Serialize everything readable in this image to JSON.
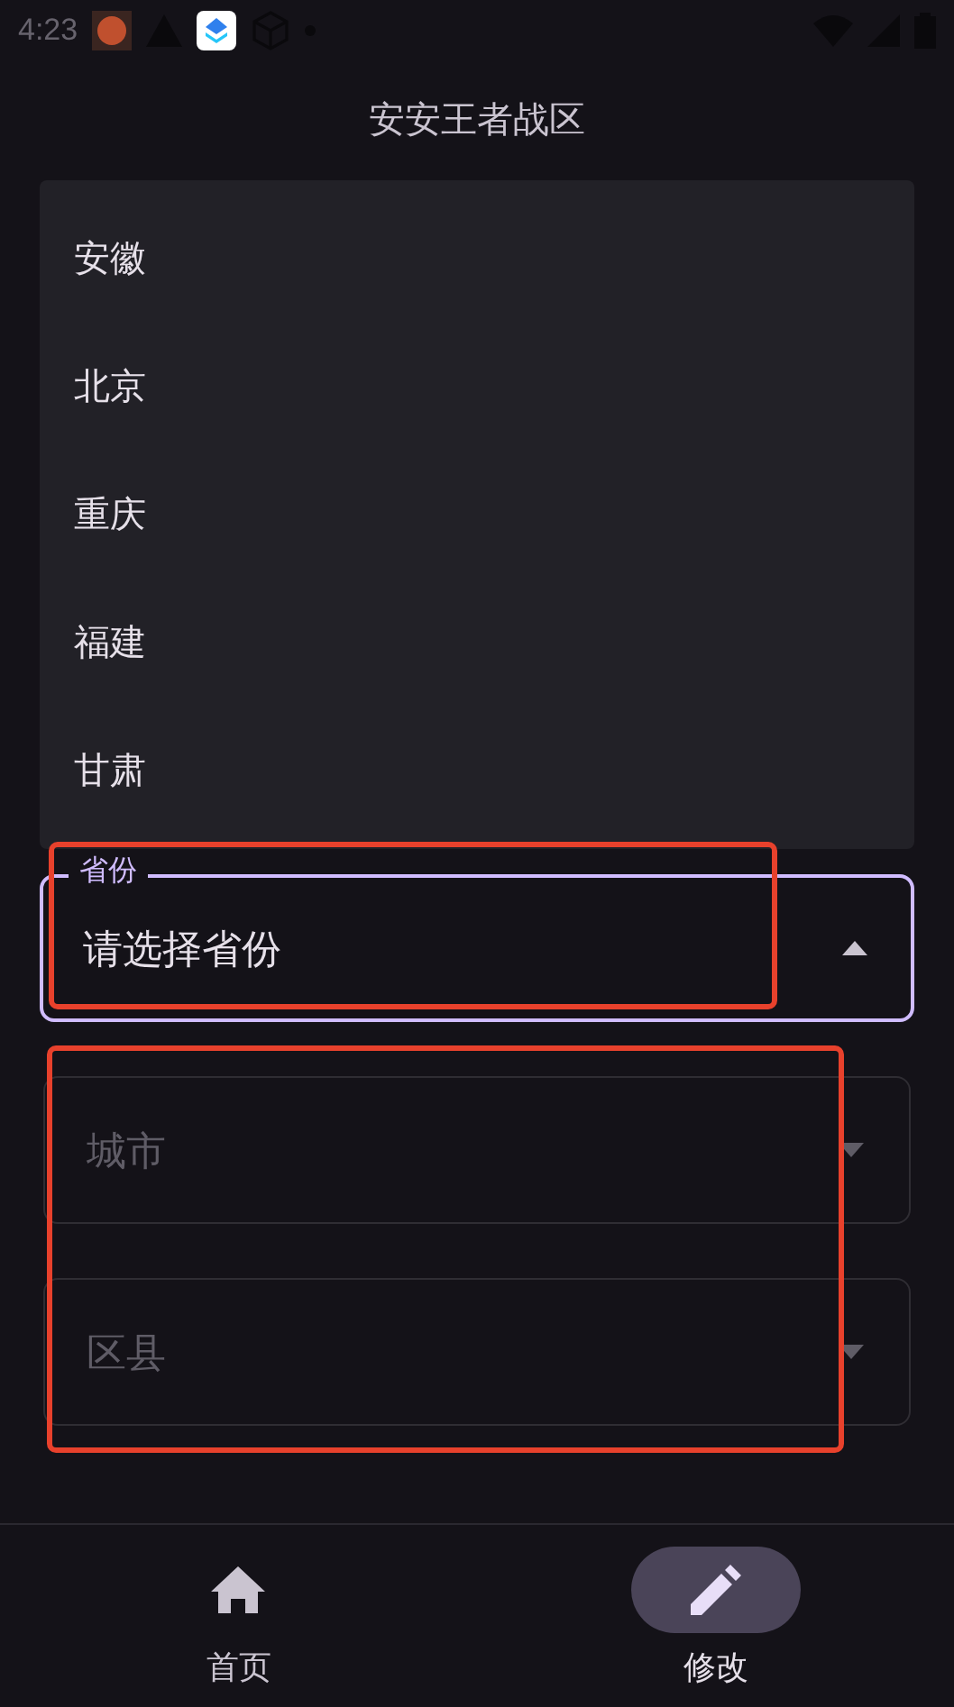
{
  "status_bar": {
    "time": "4:23"
  },
  "title": "安安王者战区",
  "menu": {
    "items": [
      "安徽",
      "北京",
      "重庆",
      "福建",
      "甘肃"
    ]
  },
  "fields": [
    {
      "label": "省份",
      "value": "请选择省份",
      "disabled": false,
      "expanded": true
    },
    {
      "placeholder": "城市",
      "disabled": true,
      "expanded": false
    },
    {
      "placeholder": "区县",
      "disabled": true,
      "expanded": false
    }
  ],
  "bottom_nav": [
    {
      "label": "首页",
      "kind": "home",
      "selected": false
    },
    {
      "label": "修改",
      "kind": "edit",
      "selected": true
    }
  ]
}
